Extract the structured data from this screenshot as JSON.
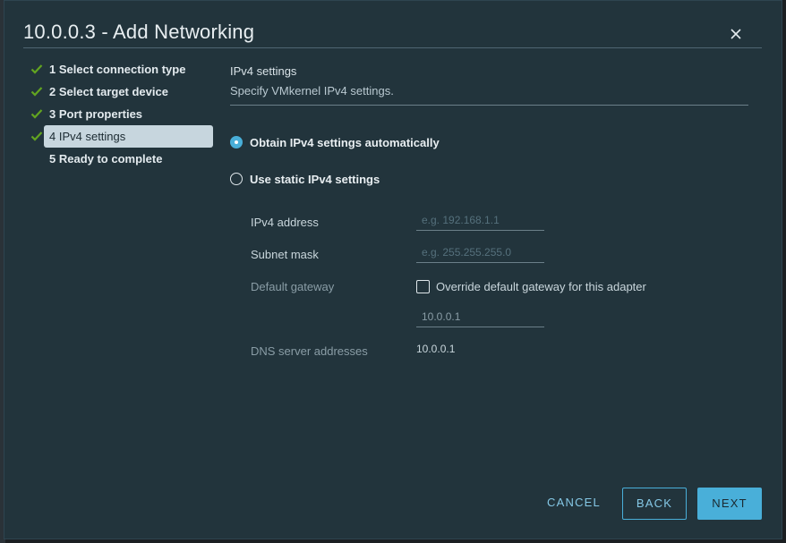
{
  "dialog": {
    "title": "10.0.0.3 - Add Networking",
    "close_icon": "close-icon"
  },
  "steps": [
    {
      "label": "1 Select connection type",
      "completed": true,
      "active": false
    },
    {
      "label": "2 Select target device",
      "completed": true,
      "active": false
    },
    {
      "label": "3 Port properties",
      "completed": true,
      "active": false
    },
    {
      "label": "4 IPv4 settings",
      "completed": true,
      "active": true
    },
    {
      "label": "5 Ready to complete",
      "completed": false,
      "active": false
    }
  ],
  "section": {
    "title": "IPv4 settings",
    "subtitle": "Specify VMkernel IPv4 settings."
  },
  "options": {
    "auto_label": "Obtain IPv4 settings automatically",
    "auto_selected": true,
    "static_label": "Use static IPv4 settings",
    "static_selected": false
  },
  "fields": {
    "ipv4_label": "IPv4 address",
    "ipv4_placeholder": "e.g. 192.168.1.1",
    "subnet_label": "Subnet mask",
    "subnet_placeholder": "e.g. 255.255.255.0",
    "gateway_label": "Default gateway",
    "override_label": "Override default gateway for this adapter",
    "override_checked": false,
    "gateway_value": "10.0.0.1",
    "dns_label": "DNS server addresses",
    "dns_value": "10.0.0.1"
  },
  "buttons": {
    "cancel": "CANCEL",
    "back": "BACK",
    "next": "NEXT"
  },
  "colors": {
    "accent": "#49afd9",
    "check": "#62a420",
    "dialog_bg": "#22343c"
  }
}
